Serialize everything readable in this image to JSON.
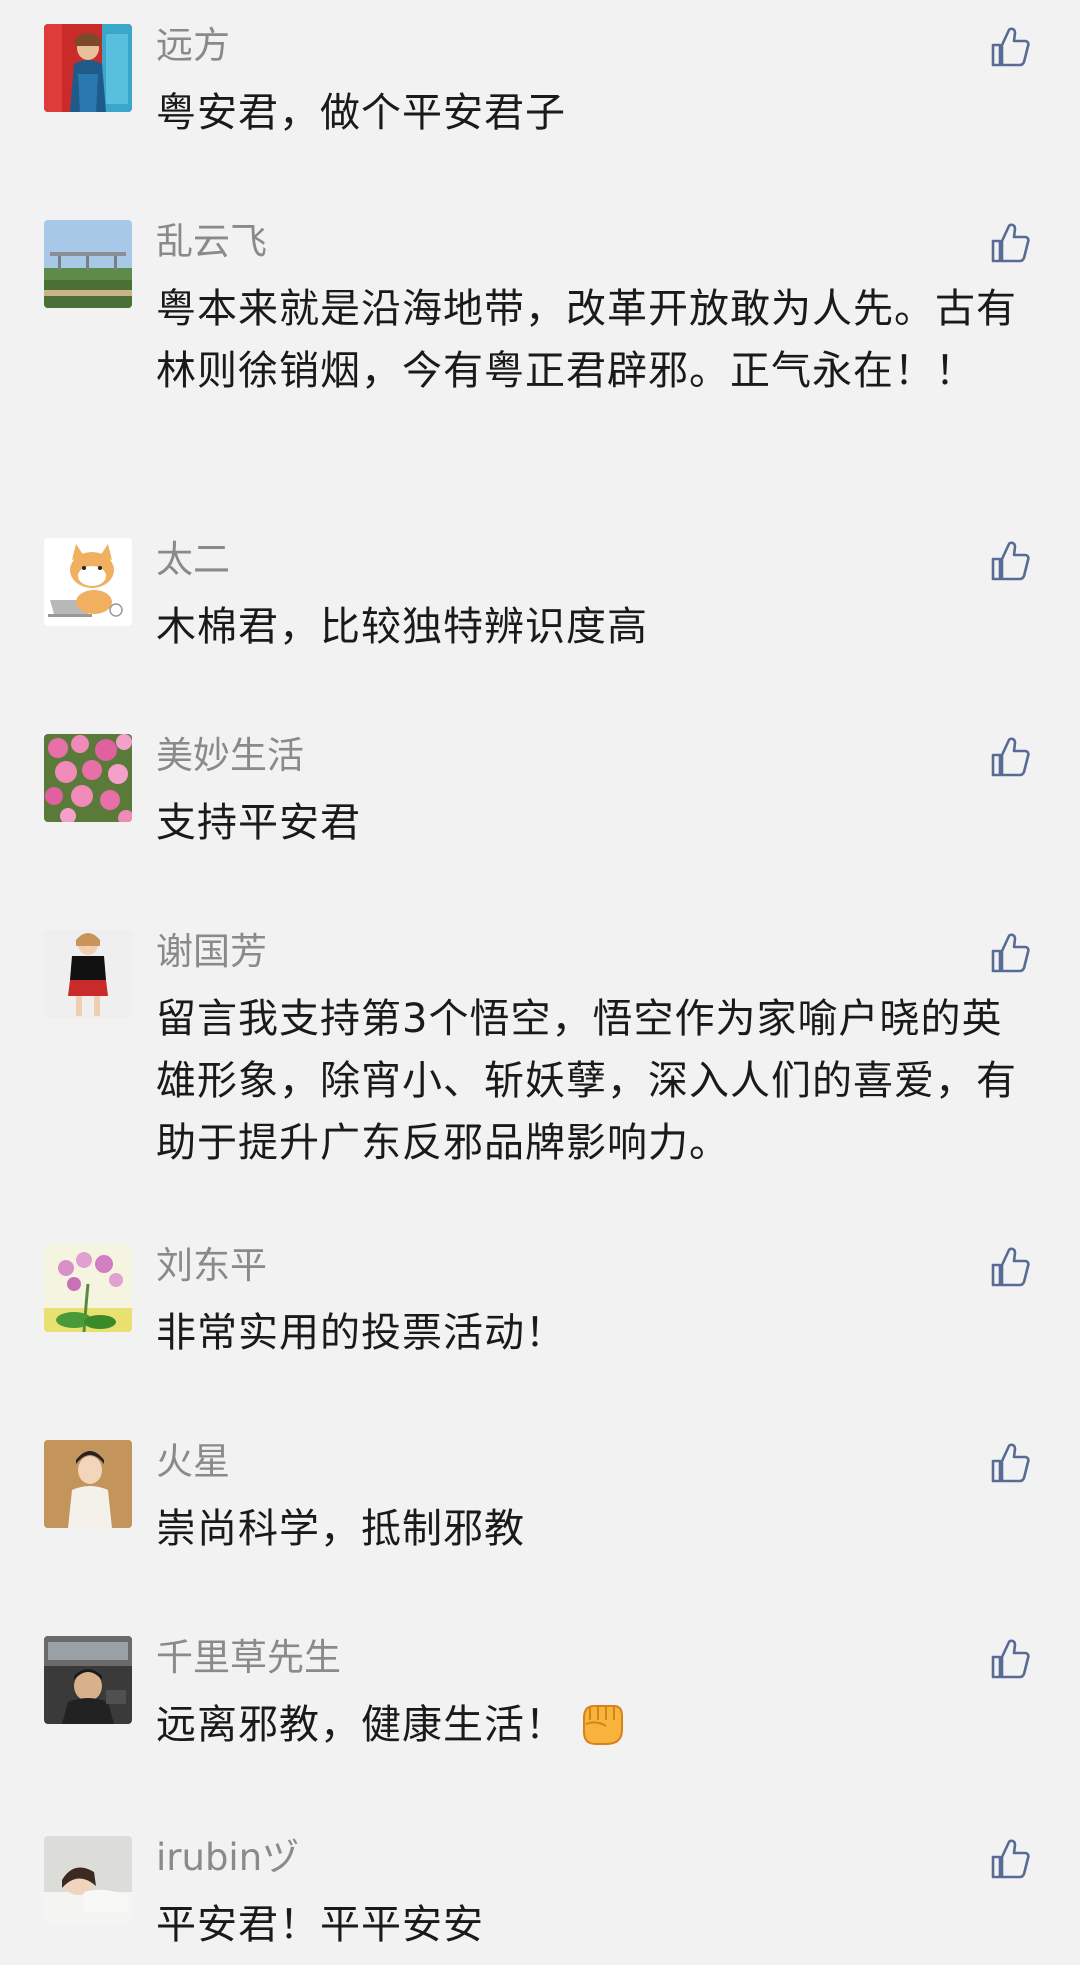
{
  "comments": [
    {
      "name": "远方",
      "text": "粤安君，做个平安君子",
      "avatar": "woman-red-background-avatar"
    },
    {
      "name": "乱云飞",
      "text": "粤本来就是沿海地带，改革开放敢为人先。古有林则徐销烟，今有粤正君辟邪。正气永在！！",
      "avatar": "bridge-landscape-avatar"
    },
    {
      "name": "太二",
      "text": "木棉君，比较独特辨识度高",
      "avatar": "cartoon-cat-laptop-avatar"
    },
    {
      "name": "美妙生活",
      "text": "支持平安君",
      "avatar": "pink-flowers-avatar"
    },
    {
      "name": "谢国芳",
      "text": "留言我支持第3个悟空，悟空作为家喻户晓的英雄形象，除宵小、斩妖孽，深入人们的喜爱，有助于提升广东反邪品牌影响力。",
      "avatar": "woman-red-skirt-avatar"
    },
    {
      "name": "刘东平",
      "text": "非常实用的投票活动！",
      "avatar": "orchid-plant-avatar"
    },
    {
      "name": "火星",
      "text": "崇尚科学，抵制邪教",
      "avatar": "person-portrait-avatar"
    },
    {
      "name": "千里草先生",
      "text": "远离邪教，健康生活！",
      "avatar": "man-in-car-avatar",
      "emoji": "fist-emoji"
    },
    {
      "name": "irubinヅ",
      "text": "平安君！平平安安",
      "avatar": "girl-lying-avatar"
    }
  ],
  "icons": {
    "like": "thumbs-up-icon"
  },
  "colors": {
    "background": "#f2f2f2",
    "name_text": "#8a8a8a",
    "comment_text": "#1a1a1a",
    "like_icon": "#576b95"
  }
}
